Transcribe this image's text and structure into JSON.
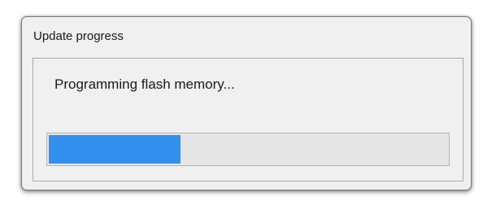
{
  "window": {
    "title": "Update progress"
  },
  "status": {
    "message": "Programming flash memory..."
  },
  "progress": {
    "fraction": 0.33,
    "fill_color": "#3390ee"
  },
  "colors": {
    "dialog_background": "#f0f0f0",
    "track_background": "#e6e6e6"
  }
}
